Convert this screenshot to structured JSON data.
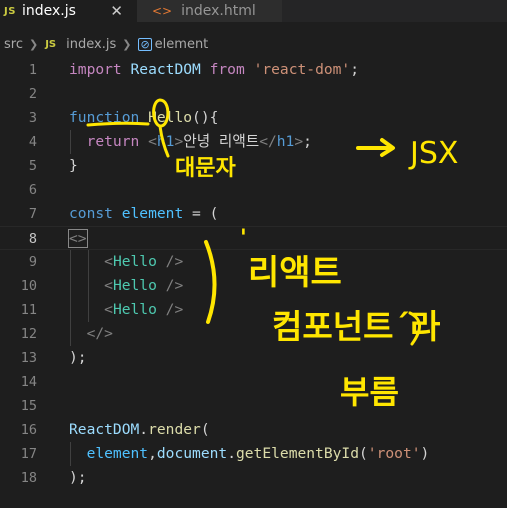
{
  "tabs": [
    {
      "icon": "JS",
      "label": "index.js",
      "close": "✕",
      "active": true
    },
    {
      "icon": "<>",
      "label": "index.html",
      "active": false
    }
  ],
  "breadcrumb": {
    "folder": "src",
    "file_icon": "JS",
    "file": "index.js",
    "symbol_icon": "⊘",
    "symbol": "element"
  },
  "line_numbers": [
    "1",
    "2",
    "3",
    "4",
    "5",
    "6",
    "7",
    "8",
    "9",
    "10",
    "11",
    "12",
    "13",
    "14",
    "15",
    "16",
    "17",
    "18"
  ],
  "code": {
    "l1": {
      "import": "import",
      "name": "ReactDOM",
      "from": "from",
      "module": "'react-dom'",
      "semi": ";"
    },
    "l3": {
      "kw": "function",
      "name": "Hello",
      "rest": "(){"
    },
    "l4": {
      "ret": "return",
      "open_lt": "<",
      "open_tag": "h1",
      "open_gt": ">",
      "text": "안녕 리액트",
      "close_lt": "</",
      "close_tag": "h1",
      "close_gt": ">",
      "semi": ";"
    },
    "l5": {
      "brace": "}"
    },
    "l7": {
      "kw": "const",
      "name": "element",
      "eq": " = ("
    },
    "l8": {
      "frag": "<>"
    },
    "l9": {
      "lt": "<",
      "comp": "Hello",
      "end": " />"
    },
    "l10": {
      "lt": "<",
      "comp": "Hello",
      "end": " />"
    },
    "l11": {
      "lt": "<",
      "comp": "Hello",
      "end": " />"
    },
    "l12": {
      "frag_close": "</>"
    },
    "l13": {
      "paren": ");"
    },
    "l16": {
      "obj": "ReactDOM",
      "dot": ".",
      "method": "render",
      "paren": "("
    },
    "l17": {
      "arg": "element",
      "comma": ",",
      "doc": "document",
      "dot": ".",
      "method": "getElementById",
      "open": "(",
      "str": "'root'",
      "close": ")"
    },
    "l18": {
      "paren": ");"
    }
  },
  "annotations": {
    "capital": "대문자",
    "jsx": "JSX",
    "react_word": "리액트",
    "component_phrase": "컴포넌트´라",
    "call_word": "부름",
    "tick": "'"
  },
  "colors": {
    "annotation": "#ffe600",
    "background": "#1e1e1e"
  }
}
